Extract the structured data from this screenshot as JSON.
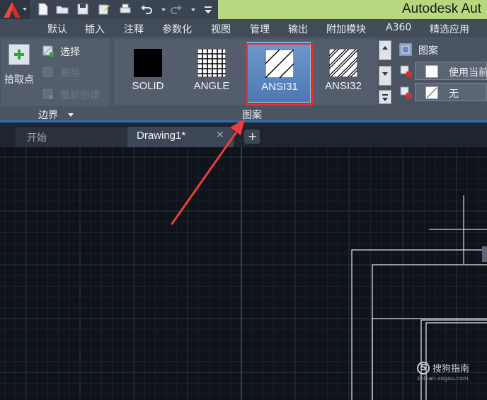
{
  "titlebar": {
    "title": "Autodesk Aut"
  },
  "menu": {
    "items": [
      "默认",
      "插入",
      "注释",
      "参数化",
      "视图",
      "管理",
      "输出",
      "附加模块",
      "A360",
      "精选应用"
    ]
  },
  "boundary_panel": {
    "pick_point_label": "拾取点",
    "select_label": "选择",
    "remove_label": "删除",
    "recreate_label": "重新创建",
    "footer_label": "边界"
  },
  "pattern_panel": {
    "footer_label": "图案",
    "patterns": [
      {
        "label": "SOLID",
        "icon": "solid-fill-icon"
      },
      {
        "label": "ANGLE",
        "icon": "angle-grid-icon"
      },
      {
        "label": "ANSI31",
        "icon": "ansi31-hatch-icon",
        "selected": true
      },
      {
        "label": "ANSI32",
        "icon": "ansi32-hatch-icon"
      }
    ]
  },
  "properties_panel": {
    "type_label": "图案",
    "color_value": "使用当前",
    "background_value": "无"
  },
  "tabs": {
    "start_label": "开始",
    "drawing_label": "Drawing1*",
    "close_glyph": "✕",
    "add_glyph": "+"
  },
  "watermark": {
    "text": "搜狗指南",
    "url": "zhinan.sogou.com"
  },
  "colors": {
    "title_accent": "#b9d77e",
    "selection_blue": "#5b86be",
    "highlight_red": "#e8302e",
    "canvas": "#0e1219"
  }
}
